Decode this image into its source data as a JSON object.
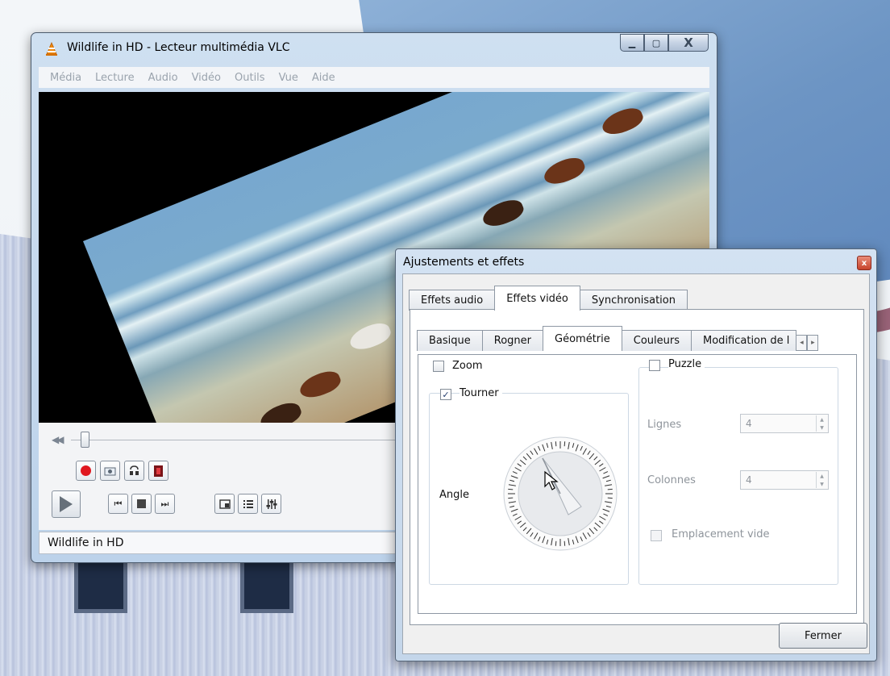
{
  "window": {
    "title": "Wildlife in HD - Lecteur multimédia VLC",
    "controls": {
      "minimize": "▁",
      "maximize": "▢",
      "close": "X"
    }
  },
  "menu": [
    "Média",
    "Lecture",
    "Audio",
    "Vidéo",
    "Outils",
    "Vue",
    "Aide"
  ],
  "status": {
    "text": "Wildlife in HD"
  },
  "icons": {
    "app": "vlc-cone-icon",
    "record": "record-icon",
    "snapshot": "snapshot-icon",
    "loop_ab": "loop-ab-icon",
    "frame_step": "frame-by-frame-icon",
    "play": "play-icon",
    "previous": "previous-icon",
    "stop": "stop-icon",
    "next": "next-icon",
    "fullscreen": "fullscreen-icon",
    "playlist": "playlist-icon",
    "extended": "extended-settings-icon"
  },
  "colors": {
    "accent": "#3b6fb6",
    "record": "#e01820",
    "title_bg": "#c8dbef"
  },
  "dialog": {
    "title": "Ajustements et effets",
    "close": "x",
    "main_tabs": [
      "Effets audio",
      "Effets vidéo",
      "Synchronisation"
    ],
    "main_active_tab": "Effets vidéo",
    "sub_tabs": [
      "Basique",
      "Rogner",
      "Géométrie",
      "Couleurs",
      "Modification de l"
    ],
    "sub_active_tab": "Géométrie",
    "zoom": {
      "label": "Zoom",
      "checked": false
    },
    "rotate": {
      "label": "Tourner",
      "checked": true,
      "angle_label": "Angle"
    },
    "puzzle": {
      "label": "Puzzle",
      "checked": false,
      "rows_label": "Lignes",
      "rows_value": "4",
      "cols_label": "Colonnes",
      "cols_value": "4",
      "empty_slot_label": "Emplacement vide"
    },
    "close_button": "Fermer"
  }
}
